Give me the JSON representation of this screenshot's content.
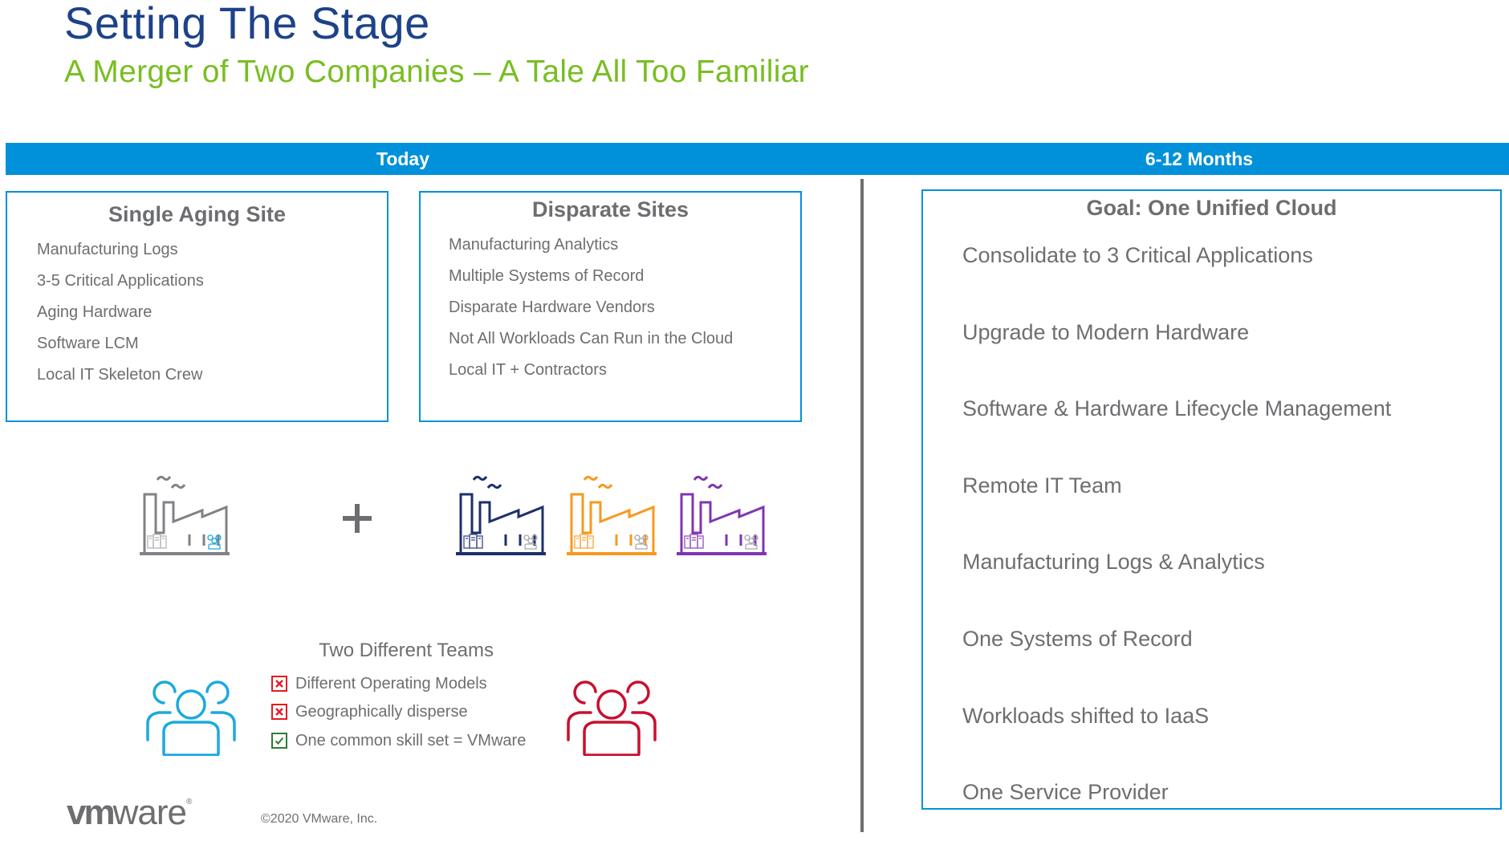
{
  "header": {
    "title": "Setting The Stage",
    "subtitle": "A Merger of Two Companies – A Tale All Too Familiar"
  },
  "timeline": {
    "today_label": "Today",
    "future_label": "6-12 Months"
  },
  "single_site": {
    "title": "Single Aging Site",
    "items": [
      "Manufacturing Logs",
      "3-5 Critical Applications",
      "Aging Hardware",
      "Software LCM",
      "Local IT Skeleton Crew"
    ]
  },
  "disparate_sites": {
    "title": "Disparate Sites",
    "items": [
      "Manufacturing Analytics",
      "Multiple Systems of Record",
      "Disparate Hardware Vendors",
      "Not All Workloads Can Run in the Cloud",
      "Local IT + Contractors"
    ]
  },
  "factories": {
    "left": [
      {
        "name": "factory-icon",
        "color": "#808285",
        "team_color": "#1ba9e1"
      }
    ],
    "operator": "plus-icon",
    "right": [
      {
        "name": "factory-icon",
        "color": "#1d2f6b",
        "team_color": "#a7a9ac"
      },
      {
        "name": "factory-icon",
        "color": "#f7991e",
        "team_color": "#a7a9ac"
      },
      {
        "name": "factory-icon",
        "color": "#7f35b2",
        "team_color": "#a7a9ac"
      }
    ]
  },
  "teams": {
    "title": "Two Different Teams",
    "left_team_color": "#1ba9e1",
    "right_team_color": "#c8102e",
    "items": [
      {
        "text": "Different Operating Models",
        "status": "x",
        "color": "#e31b23"
      },
      {
        "text": "Geographically disperse",
        "status": "x",
        "color": "#e31b23"
      },
      {
        "text": "One common skill set = VMware",
        "status": "check",
        "color": "#2e7d32"
      }
    ]
  },
  "goal": {
    "title": "Goal: One Unified Cloud",
    "items": [
      "Consolidate to 3 Critical Applications",
      "Upgrade to Modern Hardware",
      "Software & Hardware Lifecycle Management",
      "Remote IT Team",
      "Manufacturing Logs & Analytics",
      "One Systems of Record",
      "Workloads shifted to IaaS",
      "One Service Provider"
    ]
  },
  "footer": {
    "logo_bold": "vm",
    "logo_light": "ware",
    "logo_mark": "®",
    "copyright": "©2020 VMware, Inc."
  },
  "colors": {
    "title": "#1d428a",
    "subtitle": "#78be20",
    "accent_blue": "#0091da",
    "text_gray": "#6d6e71"
  }
}
